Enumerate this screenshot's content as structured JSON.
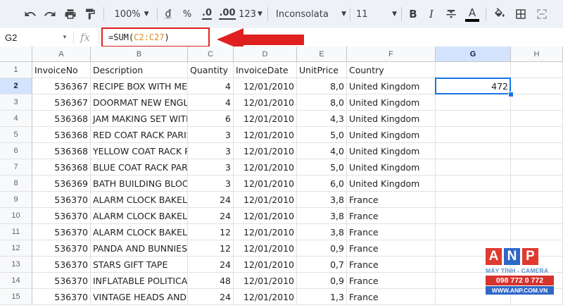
{
  "toolbar": {
    "zoom": "100%",
    "currency_symbol": "₫",
    "percent": "%",
    "decrease_decimal": ".0",
    "increase_decimal": ".00",
    "more_formats": "123",
    "font": "Inconsolata",
    "font_size": "11",
    "bold": "B",
    "italic": "I",
    "text_color": "A"
  },
  "formula_bar": {
    "cell_ref": "G2",
    "fx": "fx",
    "formula_prefix": "=SUM(",
    "formula_range": "C2:C27",
    "formula_suffix": ")"
  },
  "sheet": {
    "columns": [
      "A",
      "B",
      "C",
      "D",
      "E",
      "F",
      "G",
      "H"
    ],
    "headers": [
      "InvoiceNo",
      "Description",
      "Quantity",
      "InvoiceDate",
      "UnitPrice",
      "Country"
    ],
    "rows": [
      [
        "536367",
        "RECIPE BOX WITH METAL HEART",
        "4",
        "12/01/2010",
        "8,0",
        "United Kingdom"
      ],
      [
        "536367",
        "DOORMAT NEW ENGLAND",
        "4",
        "12/01/2010",
        "8,0",
        "United Kingdom"
      ],
      [
        "536368",
        "JAM MAKING SET WITH JARS",
        "6",
        "12/01/2010",
        "4,3",
        "United Kingdom"
      ],
      [
        "536368",
        "RED COAT RACK PARIS FASHION",
        "3",
        "12/01/2010",
        "5,0",
        "United Kingdom"
      ],
      [
        "536368",
        "YELLOW COAT RACK PARIS FASHION",
        "3",
        "12/01/2010",
        "4,0",
        "United Kingdom"
      ],
      [
        "536368",
        "BLUE COAT RACK PARIS FASHION",
        "3",
        "12/01/2010",
        "5,0",
        "United Kingdom"
      ],
      [
        "536369",
        "BATH BUILDING BLOCK WORD",
        "3",
        "12/01/2010",
        "6,0",
        "United Kingdom"
      ],
      [
        "536370",
        "ALARM CLOCK BAKELIKE PINK",
        "24",
        "12/01/2010",
        "3,8",
        "France"
      ],
      [
        "536370",
        "ALARM CLOCK BAKELIKE RED",
        "24",
        "12/01/2010",
        "3,8",
        "France"
      ],
      [
        "536370",
        "ALARM CLOCK BAKELIKE GREEN",
        "12",
        "12/01/2010",
        "3,8",
        "France"
      ],
      [
        "536370",
        "PANDA AND BUNNIES STICKER SHEET",
        "12",
        "12/01/2010",
        "0,9",
        "France"
      ],
      [
        "536370",
        "STARS GIFT TAPE",
        "24",
        "12/01/2010",
        "0,7",
        "France"
      ],
      [
        "536370",
        "INFLATABLE POLITICAL GLOBE",
        "48",
        "12/01/2010",
        "0,9",
        "France"
      ],
      [
        "536370",
        "VINTAGE HEADS AND TAILS CARD GAME",
        "24",
        "12/01/2010",
        "1,3",
        "France"
      ]
    ],
    "selected_cell_value": "472",
    "row_numbers": [
      "1",
      "2",
      "3",
      "4",
      "5",
      "6",
      "7",
      "8",
      "9",
      "10",
      "11",
      "12",
      "13",
      "14",
      "15"
    ]
  },
  "watermark": {
    "letters": [
      "A",
      "N",
      "P"
    ],
    "subtitle": "MÁY TÍNH - CAMERA",
    "phone": "098 772 0 772",
    "url": "WWW.ANP.COM.VN",
    "colors": [
      "#e03a2f",
      "#2f67c7",
      "#e03a2f"
    ]
  },
  "colors": {
    "selection": "#1a73e8",
    "highlight_box": "#e02020",
    "range_ref": "#e08a1a"
  }
}
